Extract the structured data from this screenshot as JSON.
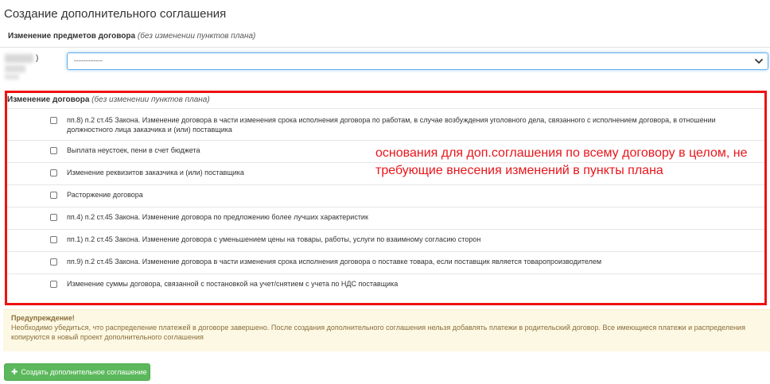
{
  "page": {
    "title": "Создание дополнительного соглашения"
  },
  "subjects_section": {
    "header": "Изменение предметов договора",
    "header_note": "(без изменении пунктов плана)",
    "label_suffix": ")",
    "select": {
      "selected": "------------"
    }
  },
  "contract_section": {
    "header": "Изменение договора",
    "header_note": "(без изменении пунктов плана)",
    "items": [
      {
        "label": "пп.8) п.2 ст.45 Закона. Изменение договора в части изменения срока исполнения договора по работам, в случае возбуждения уголовного дела, связанного с исполнением договора, в отношении должностного лица заказчика и (или) поставщика",
        "checked": false
      },
      {
        "label": "Выплата неустоек, пени в счет бюджета",
        "checked": false
      },
      {
        "label": "Изменение реквизитов заказчика и (или) поставщика",
        "checked": false
      },
      {
        "label": "Расторжение договора",
        "checked": false
      },
      {
        "label": "пп.4) п.2 ст.45 Закона. Изменение договора по предложению более лучших характеристик",
        "checked": false
      },
      {
        "label": "пп.1) п.2 ст.45 Закона. Изменение договора с уменьшением цены на товары, работы, услуги по взаимному согласию сторон",
        "checked": false
      },
      {
        "label": "пп.9) п.2 ст.45 Закона. Изменение договора в части изменения срока исполнения договора о поставке товара, если поставщик является товаропроизводителем",
        "checked": false
      },
      {
        "label": "Изменение суммы договора, связанной с постановкой на учет/снятием с учета по НДС поставщика",
        "checked": false
      }
    ]
  },
  "annotation": {
    "text": "основания для доп.соглашения по всему договору в целом, не требующие внесения изменений в пункты плана",
    "color": "#e8151b"
  },
  "warning": {
    "title": "Предупреждение!",
    "text": "Необходимо убедиться, что распределение платежей в договоре завершено. После создания дополнительного соглашения нельзя добавлять платежи в родительский договор. Все имеющиеся платежи и распределения копируются в новый проект дополнительного соглашения"
  },
  "actions": {
    "create_label": "Создать дополнительное соглашение",
    "create_icon": "plus-icon",
    "create_color": "#5cb85c"
  }
}
